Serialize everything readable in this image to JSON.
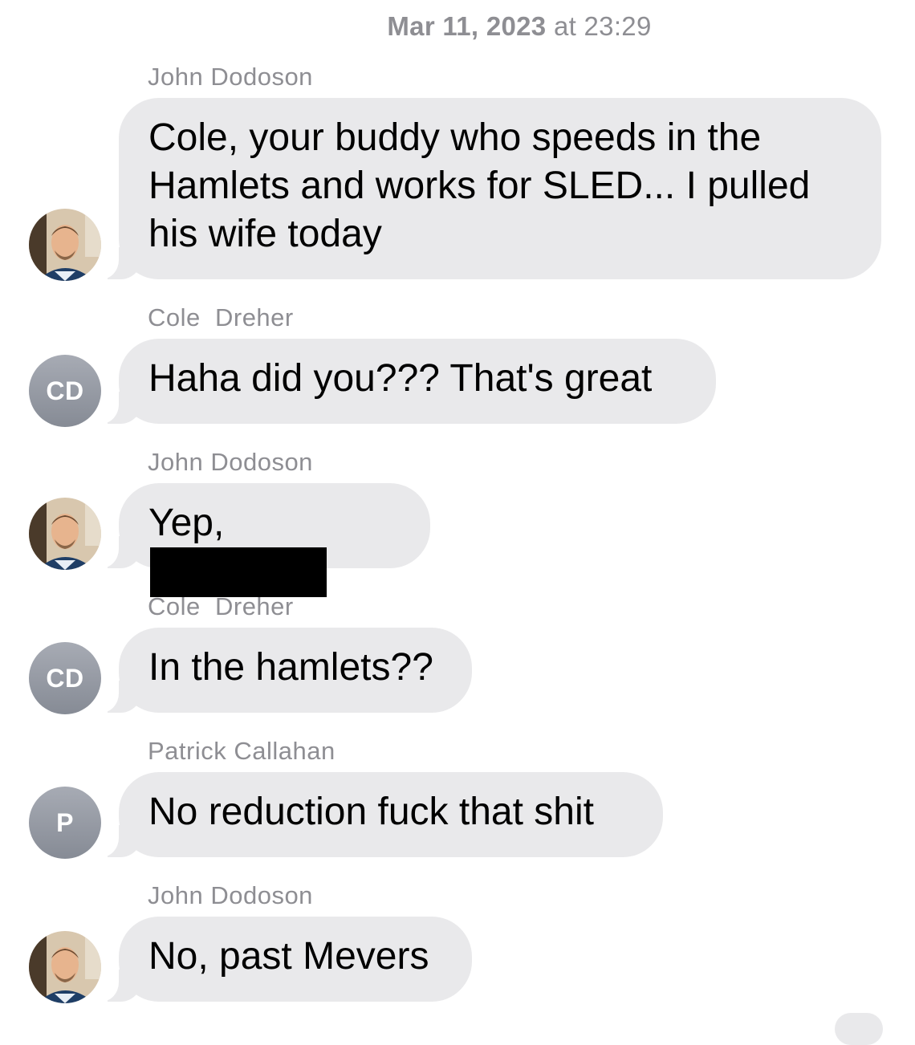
{
  "header": {
    "timestamp_date": "Mar 11, 2023",
    "timestamp_time": "at 23:29"
  },
  "messages": [
    {
      "sender": "John Dodoson",
      "avatar_type": "photo",
      "avatar_icon": "john-dodoson-photo",
      "text": "Cole, your buddy who speeds in the\nHamlets and works for SLED... I pulled\nhis wife today"
    },
    {
      "sender": "Cole  Dreher",
      "avatar_type": "initials",
      "avatar_initials": "CD",
      "text": "Haha did you??? That's great"
    },
    {
      "sender": "John Dodoson",
      "avatar_type": "photo",
      "avatar_icon": "john-dodoson-photo",
      "text": "Yep,",
      "redacted": true
    },
    {
      "sender": "Cole  Dreher",
      "avatar_type": "initials",
      "avatar_initials": "CD",
      "text": "In the hamlets??"
    },
    {
      "sender": "Patrick Callahan",
      "avatar_type": "initials",
      "avatar_initials": "P",
      "text": "No reduction fuck that shit"
    },
    {
      "sender": "John Dodoson",
      "avatar_type": "photo",
      "avatar_icon": "john-dodoson-photo",
      "text": "No, past Mevers"
    }
  ],
  "colors": {
    "bubble_incoming": "#e9e9eb",
    "meta_text": "#8e8e93",
    "avatar_initials_bg": "#9a9ea7"
  }
}
